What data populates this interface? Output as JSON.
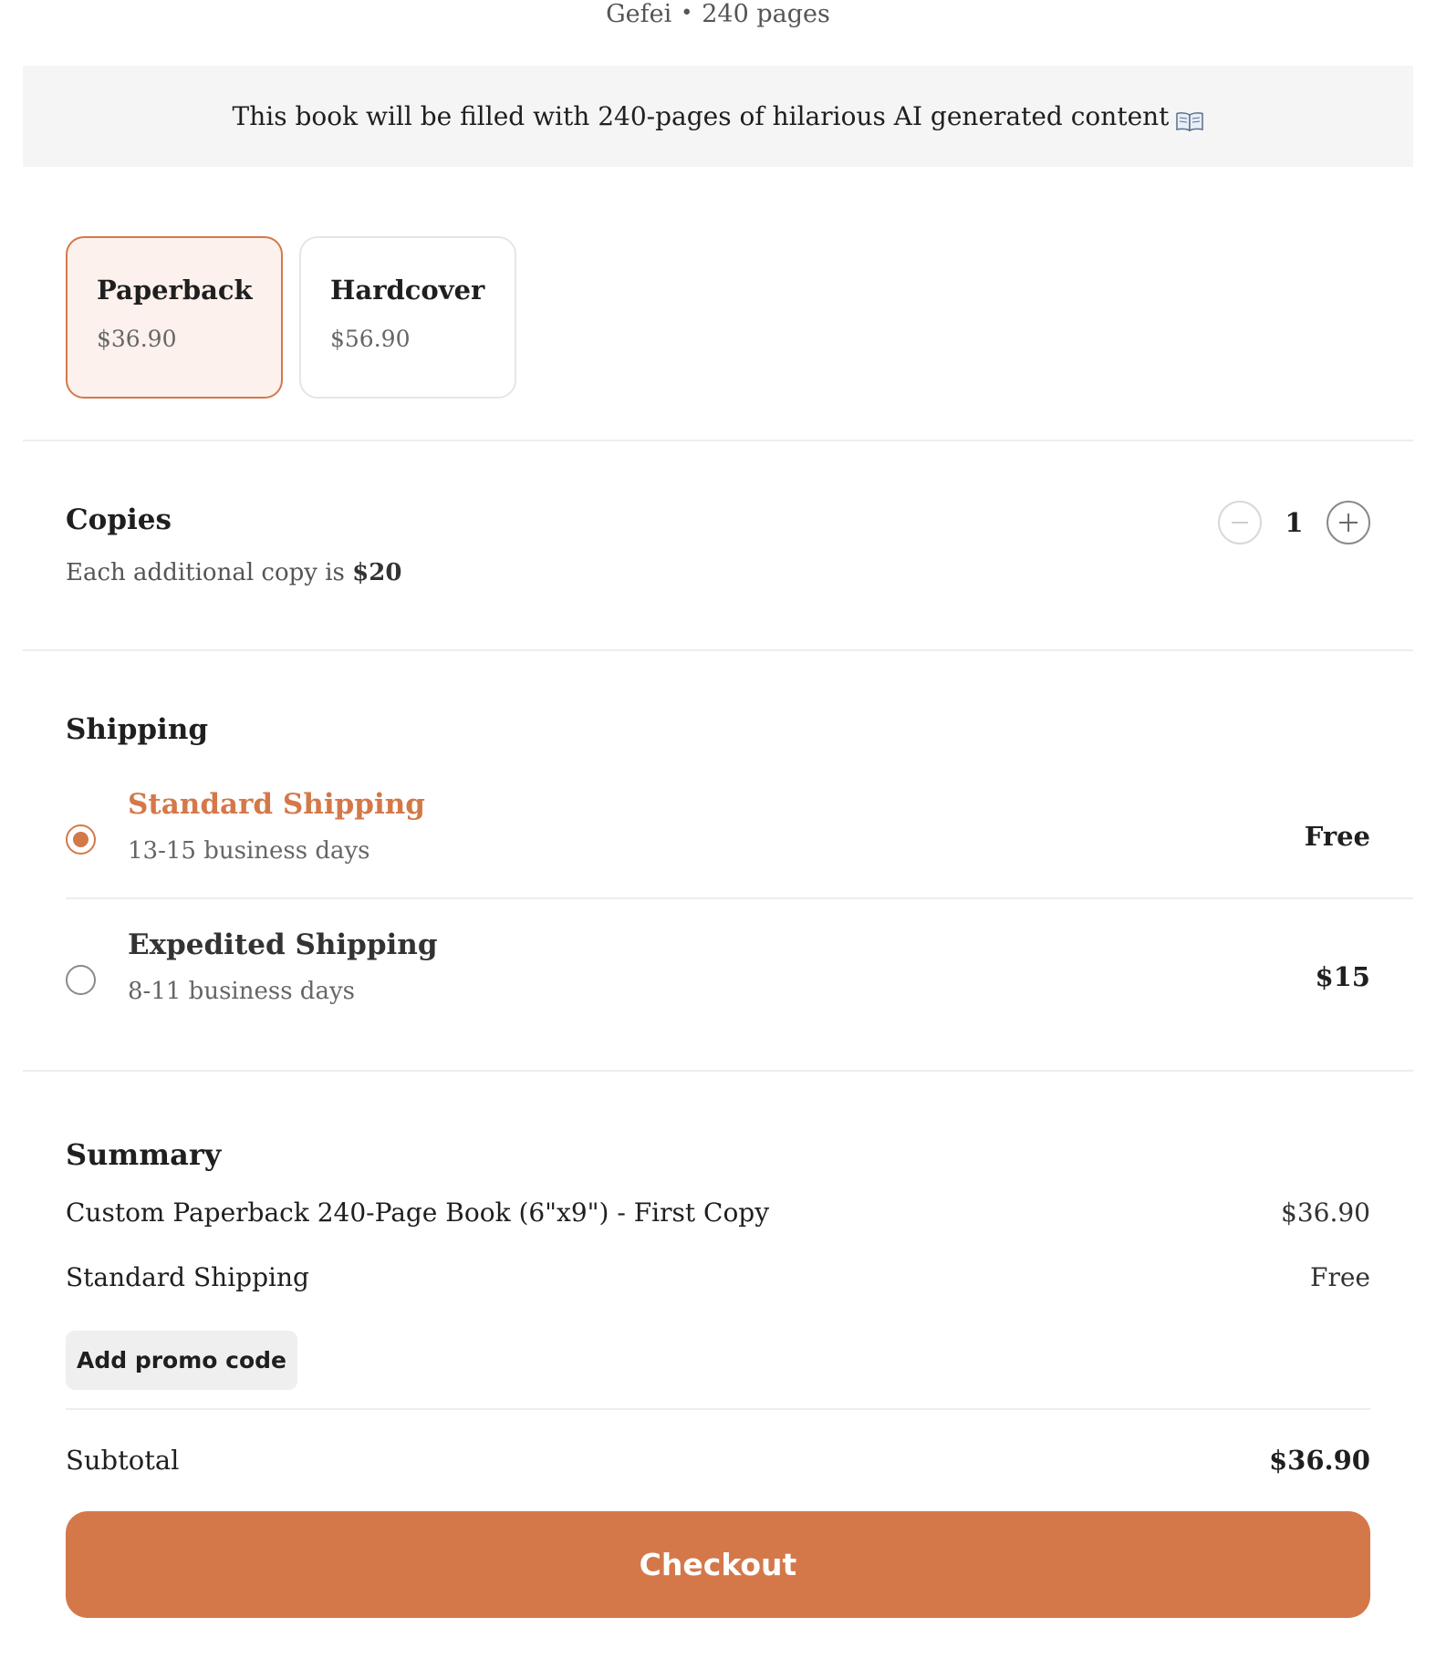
{
  "book": {
    "author": "Gefei",
    "pages_label": "240 pages",
    "separator": "•"
  },
  "banner": {
    "text": "This book will be filled with 240-pages of hilarious AI generated content",
    "icon": "open-book-icon"
  },
  "formats": [
    {
      "name": "Paperback",
      "price": "$36.90",
      "selected": true
    },
    {
      "name": "Hardcover",
      "price": "$56.90",
      "selected": false
    }
  ],
  "copies": {
    "title": "Copies",
    "subtitle_prefix": "Each additional copy is",
    "subtitle_amount": "$20",
    "quantity": "1"
  },
  "shipping": {
    "title": "Shipping",
    "options": [
      {
        "label": "Standard Shipping",
        "days": "13-15 business days",
        "cost": "Free",
        "selected": true
      },
      {
        "label": "Expedited Shipping",
        "days": "8-11 business days",
        "cost": "$15",
        "selected": false
      }
    ]
  },
  "summary": {
    "title": "Summary",
    "lines": [
      {
        "label": "Custom Paperback 240-Page Book (6\"x9\") - First Copy",
        "amount": "$36.90"
      },
      {
        "label": "Standard Shipping",
        "amount": "Free"
      }
    ],
    "promo_label": "Add promo code",
    "subtotal_label": "Subtotal",
    "subtotal_amount": "$36.90"
  },
  "checkout_label": "Checkout",
  "colors": {
    "accent": "#d4784a",
    "accent_bg": "#fcf1ec",
    "banner_bg": "#f5f5f5"
  }
}
